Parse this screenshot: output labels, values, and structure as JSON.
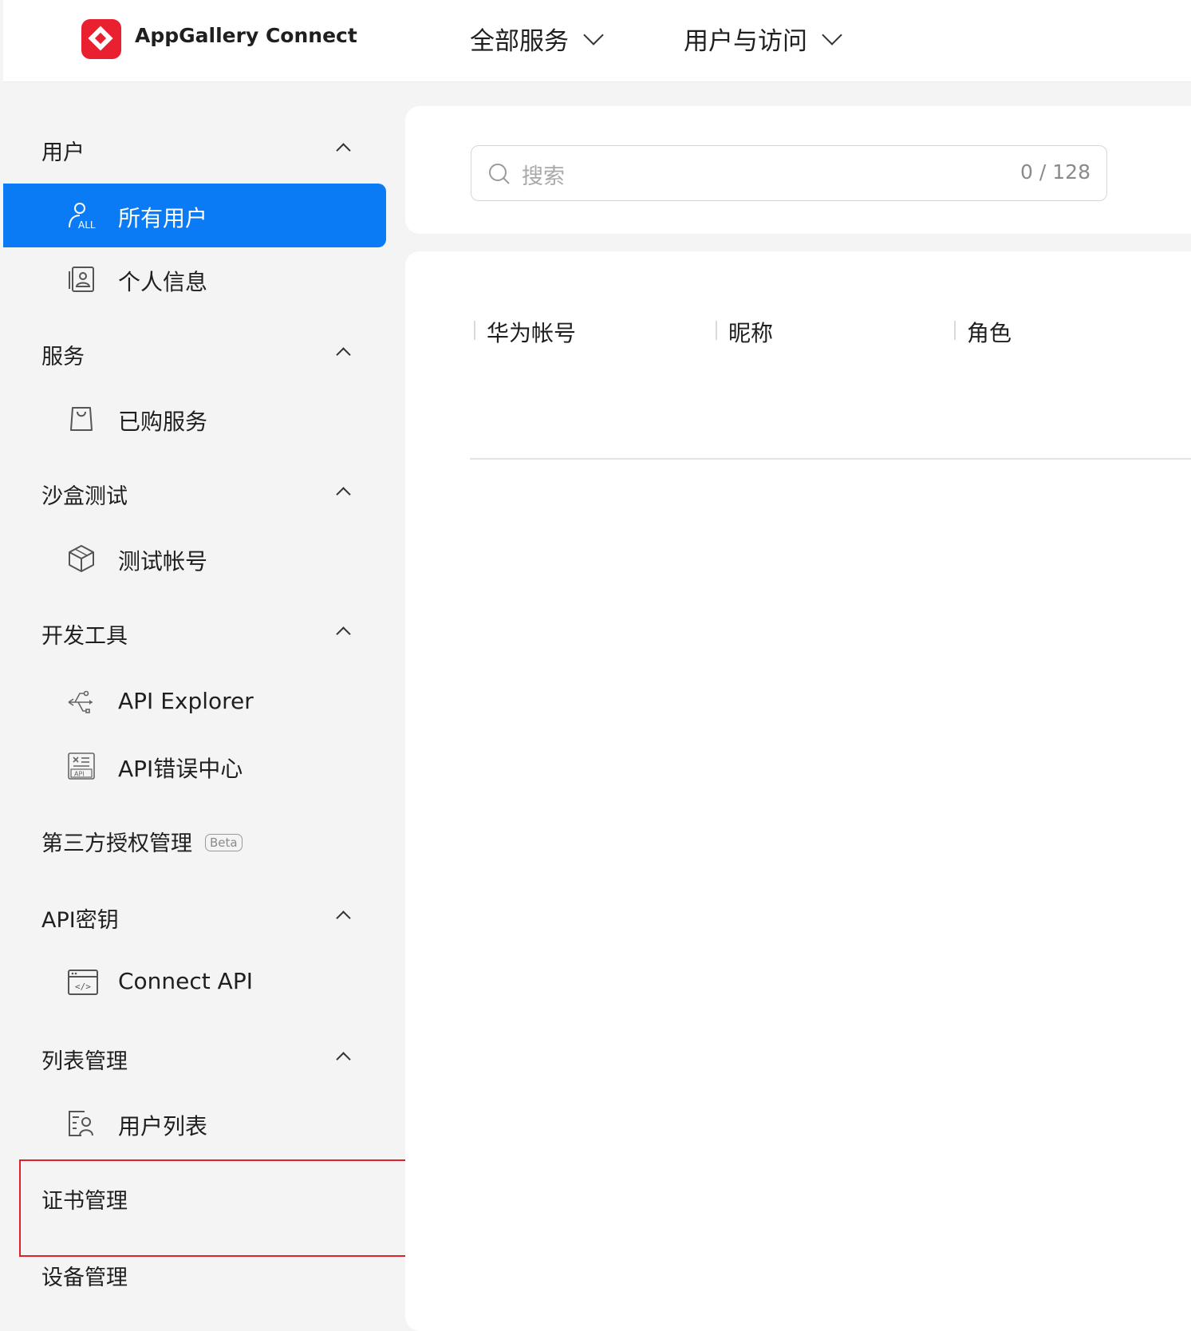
{
  "header": {
    "brand": "AppGallery Connect",
    "menus": [
      {
        "label": "全部服务"
      },
      {
        "label": "用户与访问"
      }
    ]
  },
  "sidebar": {
    "groups": [
      {
        "label": "用户",
        "items": [
          {
            "label": "所有用户",
            "icon": "all-users-icon",
            "active": true
          },
          {
            "label": "个人信息",
            "icon": "profile-icon"
          }
        ]
      },
      {
        "label": "服务",
        "items": [
          {
            "label": "已购服务",
            "icon": "shopping-bag-icon"
          }
        ]
      },
      {
        "label": "沙盒测试",
        "items": [
          {
            "label": "测试帐号",
            "icon": "cube-icon"
          }
        ]
      },
      {
        "label": "开发工具",
        "items": [
          {
            "label": "API Explorer",
            "icon": "usb-icon"
          },
          {
            "label": "API错误中心",
            "icon": "api-error-icon",
            "icon_text": "API"
          }
        ]
      },
      {
        "label": "第三方授权管理",
        "badge": "Beta"
      },
      {
        "label": "API密钥",
        "items": [
          {
            "label": "Connect API",
            "icon": "code-window-icon",
            "icon_text": "</>"
          }
        ]
      },
      {
        "label": "列表管理",
        "items": [
          {
            "label": "用户列表",
            "icon": "user-list-icon"
          }
        ]
      },
      {
        "label": "证书管理"
      },
      {
        "label": "设备管理"
      }
    ],
    "all_icon_text": "ALL"
  },
  "search": {
    "placeholder": "搜索",
    "counter": "0 / 128"
  },
  "table": {
    "columns": [
      "华为帐号",
      "昵称",
      "角色"
    ]
  },
  "colors": {
    "accent": "#0a7bf5",
    "brand_red": "#e8202f",
    "highlight": "#e0202a"
  }
}
